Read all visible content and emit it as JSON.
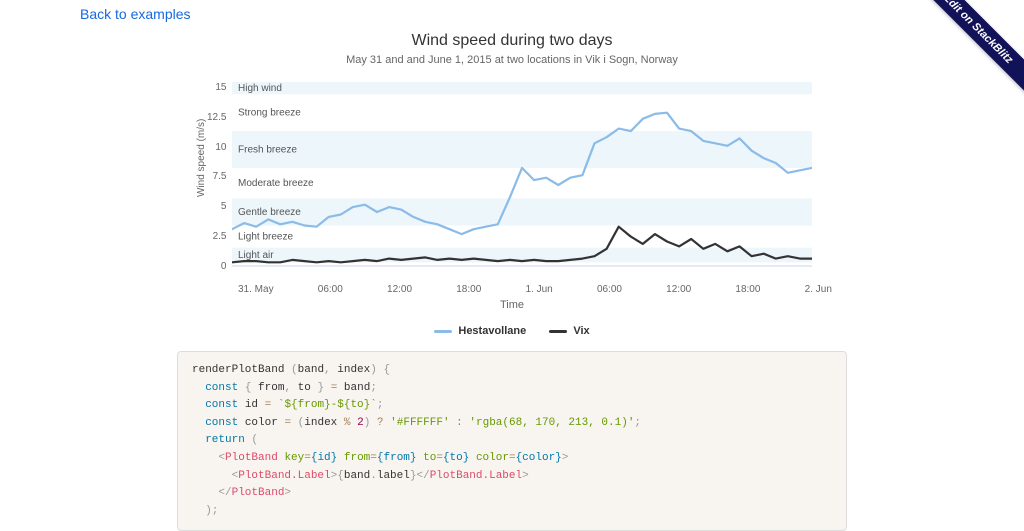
{
  "nav": {
    "back_link": "Back to examples",
    "ribbon": "Edit on StackBlitz"
  },
  "chart": {
    "title": "Wind speed during two days",
    "subtitle": "May 31 and and June 1, 2015 at two locations in Vik i Sogn, Norway",
    "y_label": "Wind speed (m/s)",
    "x_label": "Time",
    "y_ticks": [
      "0",
      "2.5",
      "5",
      "7.5",
      "10",
      "12.5",
      "15"
    ],
    "x_ticks": [
      "31. May",
      "06:00",
      "12:00",
      "18:00",
      "1. Jun",
      "06:00",
      "12:00",
      "18:00",
      "2. Jun"
    ],
    "bands": [
      {
        "label": "Light air",
        "from": 0.3,
        "to": 1.5
      },
      {
        "label": "Light breeze",
        "from": 1.5,
        "to": 3.3
      },
      {
        "label": "Gentle breeze",
        "from": 3.3,
        "to": 5.5
      },
      {
        "label": "Moderate breeze",
        "from": 5.5,
        "to": 8
      },
      {
        "label": "Fresh breeze",
        "from": 8,
        "to": 11
      },
      {
        "label": "Strong breeze",
        "from": 11,
        "to": 14
      },
      {
        "label": "High wind",
        "from": 14,
        "to": 15
      }
    ],
    "legend": [
      {
        "name": "Hestavollane",
        "color": "#8bbbe8"
      },
      {
        "name": "Vix",
        "color": "#333333"
      }
    ]
  },
  "chart_data": {
    "type": "line",
    "title": "Wind speed during two days",
    "xlabel": "Time",
    "ylabel": "Wind speed (m/s)",
    "ylim": [
      0,
      15
    ],
    "x": [
      0,
      1,
      2,
      3,
      4,
      5,
      6,
      7,
      8,
      9,
      10,
      11,
      12,
      13,
      14,
      15,
      16,
      17,
      18,
      19,
      20,
      21,
      22,
      23,
      24,
      25,
      26,
      27,
      28,
      29,
      30,
      31,
      32,
      33,
      34,
      35,
      36,
      37,
      38,
      39,
      40,
      41,
      42,
      43,
      44,
      45,
      46,
      47,
      48
    ],
    "x_tick_labels": [
      "31. May",
      "06:00",
      "12:00",
      "18:00",
      "1. Jun",
      "06:00",
      "12:00",
      "18:00",
      "2. Jun"
    ],
    "series": [
      {
        "name": "Hestavollane",
        "color": "#8bbbe8",
        "values": [
          3.0,
          3.5,
          3.2,
          3.8,
          3.4,
          3.6,
          3.3,
          3.2,
          4.0,
          4.2,
          4.8,
          5.0,
          4.4,
          4.8,
          4.6,
          4.0,
          3.6,
          3.4,
          3.0,
          2.6,
          3.0,
          3.2,
          3.4,
          5.6,
          8.0,
          7.0,
          7.2,
          6.6,
          7.2,
          7.4,
          10.0,
          10.5,
          11.2,
          11.0,
          12.0,
          12.4,
          12.5,
          11.2,
          11.0,
          10.2,
          10.0,
          9.8,
          10.4,
          9.4,
          8.8,
          8.4,
          7.6,
          7.8,
          8.0
        ]
      },
      {
        "name": "Vix",
        "color": "#333333",
        "values": [
          0.3,
          0.4,
          0.4,
          0.3,
          0.3,
          0.5,
          0.4,
          0.3,
          0.4,
          0.3,
          0.4,
          0.5,
          0.4,
          0.6,
          0.5,
          0.6,
          0.7,
          0.5,
          0.6,
          0.5,
          0.6,
          0.5,
          0.4,
          0.5,
          0.4,
          0.5,
          0.4,
          0.4,
          0.5,
          0.6,
          0.8,
          1.4,
          3.2,
          2.4,
          1.8,
          2.6,
          2.0,
          1.6,
          2.2,
          1.4,
          1.8,
          1.2,
          1.6,
          0.8,
          1.0,
          0.6,
          0.8,
          0.6,
          0.6
        ]
      }
    ],
    "plot_bands": [
      {
        "label": "Light air",
        "from": 0.3,
        "to": 1.5
      },
      {
        "label": "Light breeze",
        "from": 1.5,
        "to": 3.3
      },
      {
        "label": "Gentle breeze",
        "from": 3.3,
        "to": 5.5
      },
      {
        "label": "Moderate breeze",
        "from": 5.5,
        "to": 8
      },
      {
        "label": "Fresh breeze",
        "from": 8,
        "to": 11
      },
      {
        "label": "Strong breeze",
        "from": 11,
        "to": 14
      },
      {
        "label": "High wind",
        "from": 14,
        "to": 15
      }
    ]
  },
  "code": {
    "fn": "renderPlotBand",
    "args": "(band, index)",
    "id_template": "`${from}-${to}`",
    "color_even": "'#FFFFFF'",
    "color_odd": "'rgba(68, 170, 213, 0.1)'"
  }
}
